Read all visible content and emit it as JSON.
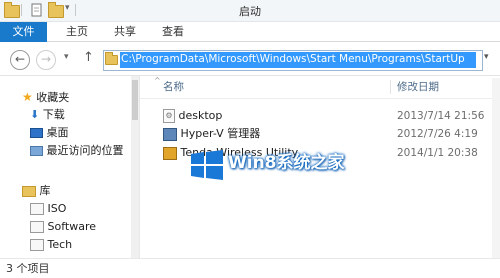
{
  "window": {
    "title": "启动"
  },
  "ribbon": {
    "tabs": [
      "文件",
      "主页",
      "共享",
      "查看"
    ]
  },
  "address": {
    "path": "C:\\ProgramData\\Microsoft\\Windows\\Start Menu\\Programs\\StartUp"
  },
  "nav": {
    "favorites_label": "收藏夹",
    "favorites": [
      "下载",
      "桌面",
      "最近访问的位置"
    ],
    "libraries_label": "库",
    "libraries": [
      "ISO",
      "Software",
      "Tech"
    ]
  },
  "list": {
    "columns": {
      "name": "名称",
      "modified": "修改日期"
    },
    "rows": [
      {
        "name": "desktop",
        "modified": "2013/7/14 21:56",
        "icon": "settings-file-icon"
      },
      {
        "name": "Hyper-V 管理器",
        "modified": "2012/7/26 4:19",
        "icon": "shortcut-icon"
      },
      {
        "name": "Tenda Wireless Utility",
        "modified": "2014/1/1 20:38",
        "icon": "shortcut-icon"
      }
    ]
  },
  "status": {
    "text": "3 个项目"
  },
  "watermark": {
    "text": "Win8系统之家"
  }
}
